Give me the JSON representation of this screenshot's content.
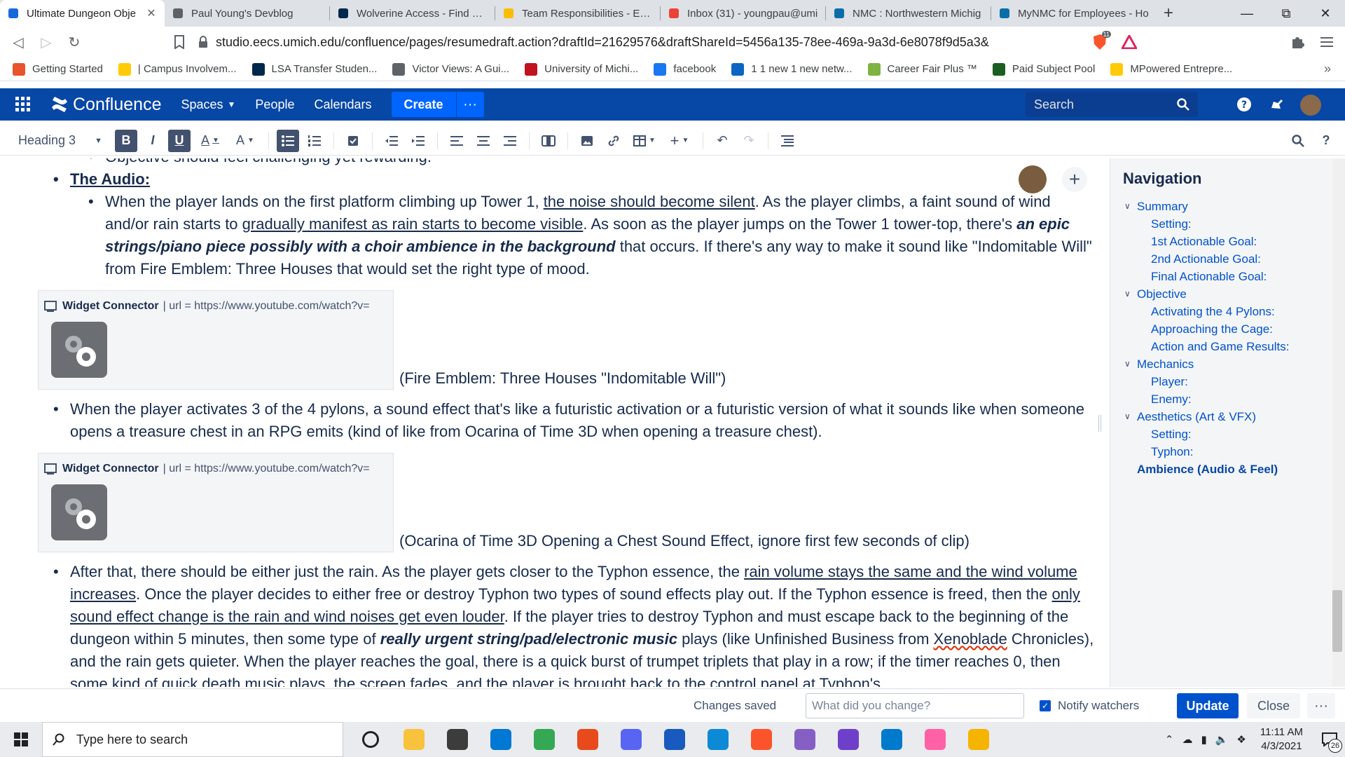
{
  "browser": {
    "tabs": [
      {
        "title": "Ultimate Dungeon Obje",
        "active": true,
        "color": "#1868db"
      },
      {
        "title": "Paul Young's Devblog",
        "active": false,
        "color": "#5f6368"
      },
      {
        "title": "Wolverine Access - Find & Fa",
        "active": false,
        "color": "#00274c"
      },
      {
        "title": "Team Responsibilities - ENTR",
        "active": false,
        "color": "#fbbc04"
      },
      {
        "title": "Inbox (31) - youngpau@umi",
        "active": false,
        "color": "#ea4335"
      },
      {
        "title": "NMC : Northwestern Michig",
        "active": false,
        "color": "#0b6ea8"
      },
      {
        "title": "MyNMC for Employees - Ho",
        "active": false,
        "color": "#0b6ea8"
      }
    ],
    "url": "studio.eecs.umich.edu/confluence/pages/resumedraft.action?draftId=21629576&draftShareId=5456a135-78ee-469a-9a3d-6e8078f9d5a3&",
    "shield_badge": "11",
    "bookmarks": [
      {
        "label": "Getting Started",
        "color": "#e8542d"
      },
      {
        "label": "| Campus Involvem...",
        "color": "#ffcb05"
      },
      {
        "label": "LSA Transfer Studen...",
        "color": "#00274c"
      },
      {
        "label": "Victor Views: A Gui...",
        "color": "#5f6368"
      },
      {
        "label": "University of Michi...",
        "color": "#c1121f"
      },
      {
        "label": "facebook",
        "color": "#1877f2"
      },
      {
        "label": "1 1 new 1 new netw...",
        "color": "#0a66c2"
      },
      {
        "label": "Career Fair Plus ™",
        "color": "#7cb342"
      },
      {
        "label": "Paid Subject Pool",
        "color": "#1b5e20"
      },
      {
        "label": "MPowered Entrepre...",
        "color": "#ffcb05"
      }
    ]
  },
  "confluence": {
    "brand": "Confluence",
    "nav": {
      "spaces": "Spaces",
      "people": "People",
      "calendars": "Calendars"
    },
    "create": "Create",
    "more": "···",
    "search_placeholder": "Search",
    "accent": "#0747a6"
  },
  "toolbar": {
    "style": "Heading 3",
    "bold": "B",
    "italic": "I",
    "underline": "U",
    "textcolor": "A"
  },
  "doc": {
    "line0": "Objective should feel challenging yet rewarding.",
    "audio_heading": "The Audio:",
    "p1": {
      "a": "When the player lands on the first platform climbing up Tower 1, ",
      "b": "the noise should become silent",
      "c": ". As the player climbs, a faint sound of wind and/or rain starts to ",
      "d": "gradually manifest as rain starts to become visible",
      "e": ". As soon as the player jumps on the Tower 1 tower-top, there's ",
      "f": "an epic strings/piano piece possibly with a choir ambience in the background",
      "g": " that occurs. If there's any way to make it sound like \"Indomitable Will\" from Fire Emblem: Three Houses that would set the right type of mood."
    },
    "widget1": {
      "title": "Widget Connector",
      "url": "| url = https://www.youtube.com/watch?v=",
      "caption": "(Fire Emblem: Three Houses \"Indomitable Will\")"
    },
    "p2": "When the player activates 3 of the 4 pylons, a sound effect that's like a futuristic activation or a futuristic version of what it sounds like when someone opens a treasure chest in an RPG emits (kind of like from Ocarina of Time 3D when opening a treasure chest).",
    "widget2": {
      "title": "Widget Connector",
      "url": "| url = https://www.youtube.com/watch?v=",
      "caption": "(Ocarina of Time 3D Opening a Chest Sound Effect, ignore first few seconds of clip)"
    },
    "p3": {
      "a": "After that, there should be either just the rain. As the player gets closer to the Typhon essence, the ",
      "b": "rain volume stays the same and the wind volume increases",
      "c": ". Once the player decides to either free or destroy Typhon two types of sound effects play out. If the Typhon essence is freed, then the ",
      "d": "only sound effect change is the rain and wind noises get even louder",
      "e": ". If the player tries to destroy Typhon and must escape back to the beginning of the dungeon within 5 minutes, then some type of ",
      "f": "really urgent string/pad/electronic music",
      "g": " plays (like Unfinished Business from ",
      "h": "Xenoblade",
      "i": " Chronicles), and the rain gets quieter. When the player reaches the goal, there is a quick burst of trumpet triplets that play in a row; if the timer reaches 0, then some kind of quick death music plays, the screen fades, and the player is brought back to the control panel at Typhon's"
    }
  },
  "navigation": {
    "title": "Navigation",
    "items": [
      {
        "label": "Summary",
        "level": 1
      },
      {
        "label": "Setting:",
        "level": 2
      },
      {
        "label": "1st Actionable Goal:",
        "level": 2
      },
      {
        "label": "2nd Actionable Goal:",
        "level": 2
      },
      {
        "label": "Final Actionable Goal:",
        "level": 2
      },
      {
        "label": "Objective",
        "level": 1
      },
      {
        "label": "Activating the 4 Pylons:",
        "level": 2
      },
      {
        "label": "Approaching the Cage:",
        "level": 2
      },
      {
        "label": "Action and Game Results:",
        "level": 2
      },
      {
        "label": "Mechanics",
        "level": 1
      },
      {
        "label": "Player:",
        "level": 2
      },
      {
        "label": "Enemy:",
        "level": 2
      },
      {
        "label": "Aesthetics (Art & VFX)",
        "level": 1
      },
      {
        "label": "Setting:",
        "level": 2
      },
      {
        "label": "Typhon:",
        "level": 2
      },
      {
        "label": "Ambience (Audio & Feel)",
        "level": 0
      }
    ]
  },
  "footer": {
    "status": "Changes saved",
    "change_placeholder": "What did you change?",
    "notify": "Notify watchers",
    "update": "Update",
    "close": "Close",
    "more": "···"
  },
  "taskbar": {
    "search_placeholder": "Type here to search",
    "time": "11:11 AM",
    "date": "4/3/2021",
    "notifications": "26",
    "apps": [
      {
        "icon": "task-view-icon",
        "color": "#202124"
      },
      {
        "icon": "file-explorer-icon",
        "color": "#f9c23c"
      },
      {
        "icon": "store-icon",
        "color": "#3c3c3c"
      },
      {
        "icon": "mail-icon",
        "color": "#0078d4"
      },
      {
        "icon": "chrome-icon",
        "color": "#34a853"
      },
      {
        "icon": "office-icon",
        "color": "#e84a1c"
      },
      {
        "icon": "discord-icon",
        "color": "#5865f2"
      },
      {
        "icon": "word-icon",
        "color": "#185abd"
      },
      {
        "icon": "edge-icon",
        "color": "#0c8ad6"
      },
      {
        "icon": "brave-icon",
        "color": "#fb542b"
      },
      {
        "icon": "visual-studio-icon",
        "color": "#865fc5"
      },
      {
        "icon": "github-icon",
        "color": "#6e40c9"
      },
      {
        "icon": "vscode-icon",
        "color": "#007acc"
      },
      {
        "icon": "creative-cloud-icon",
        "color": "#ff61a6"
      },
      {
        "icon": "chrome-canary-icon",
        "color": "#f4b400"
      }
    ]
  }
}
